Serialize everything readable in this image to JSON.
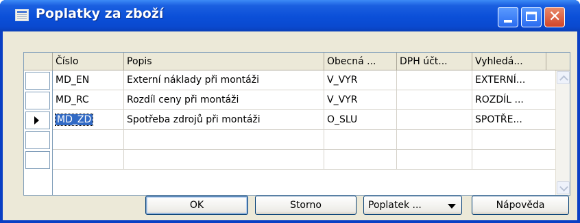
{
  "window": {
    "title": "Poplatky za zboží"
  },
  "grid": {
    "columns": [
      "Číslo",
      "Popis",
      "Obecná ...",
      "DPH účt...",
      "Vyhledá..."
    ],
    "rows": [
      {
        "cislo": "MD_EN",
        "popis": "Externí náklady při montáži",
        "obecna": "V_VYR",
        "dph": "",
        "vyhleda": "EXTERNÍ..."
      },
      {
        "cislo": "MD_RC",
        "popis": "Rozdíl ceny při montáži",
        "obecna": "V_VYR",
        "dph": "",
        "vyhleda": "ROZDÍL ..."
      },
      {
        "cislo": "MD_ZD",
        "popis": "Spotřeba zdrojů při montáži",
        "obecna": "O_SLU",
        "dph": "",
        "vyhleda": "SPOTŘE..."
      },
      {
        "cislo": "",
        "popis": "",
        "obecna": "",
        "dph": "",
        "vyhleda": ""
      },
      {
        "cislo": "",
        "popis": "",
        "obecna": "",
        "dph": "",
        "vyhleda": ""
      }
    ],
    "current_row": 2
  },
  "buttons": {
    "ok": "OK",
    "storno": "Storno",
    "poplatek": "Poplatek ...",
    "napoveda": "Nápověda"
  },
  "icons": [
    "window-app-icon",
    "minimize-icon",
    "maximize-icon",
    "close-icon",
    "row-pointer-icon",
    "scroll-up-icon",
    "scroll-down-icon",
    "dropdown-arrow-icon"
  ]
}
